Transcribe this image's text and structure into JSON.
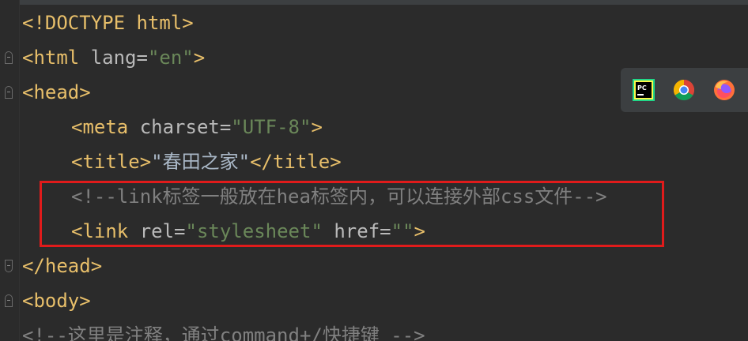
{
  "editor": {
    "lines": [
      {
        "tag_open": "<!DOCTYPE html>"
      },
      {
        "tag_start": "<html ",
        "attr": "lang=",
        "val": "\"en\"",
        "tag_end": ">"
      },
      {
        "tag": "<head>"
      },
      {
        "tag_start": "<meta ",
        "attr": "charset=",
        "val": "\"UTF-8\"",
        "tag_end": ">"
      },
      {
        "tag_start": "<title>",
        "text": "\"春田之家\"",
        "tag_end": "</title>"
      },
      {
        "comment": "<!--link标签一般放在hea标签内，可以连接外部css文件-->"
      },
      {
        "tag_start": "<link ",
        "attr1": "rel=",
        "val1": "\"stylesheet\"",
        "attr2": " href=",
        "val2": "\"\"",
        "tag_end": ">"
      },
      {
        "tag": "</head>"
      },
      {
        "tag": "<body>"
      },
      {
        "comment": "<!--这里是注释，通过command+/快捷键 -->"
      }
    ]
  },
  "browser_icons": [
    "pycharm-icon",
    "chrome-icon",
    "firefox-icon"
  ],
  "colors": {
    "background": "#2b2b2b",
    "tag": "#e8bf6a",
    "attribute": "#bababa",
    "string": "#6a8759",
    "comment": "#808080",
    "highlight": "#e01b1b"
  }
}
